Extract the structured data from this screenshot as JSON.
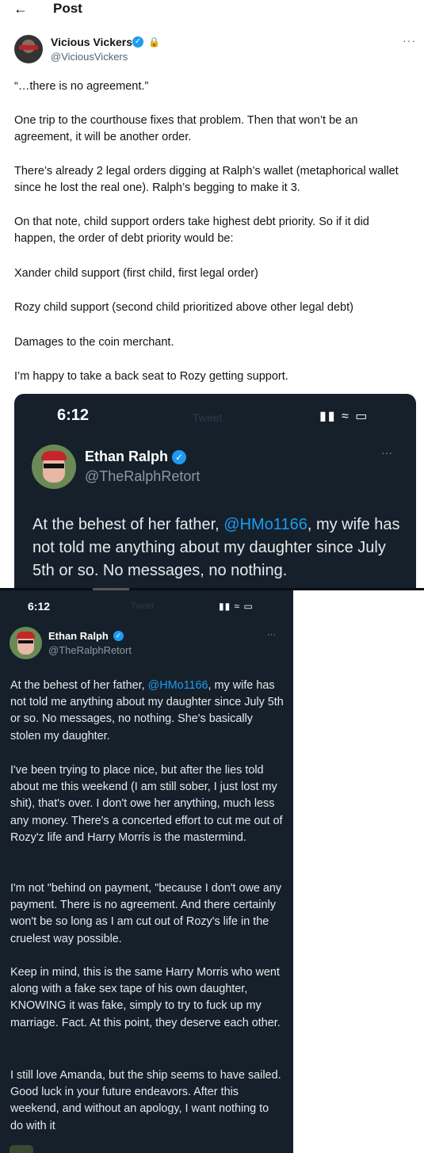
{
  "header": {
    "back_icon": "arrow-left-icon",
    "title": "Post"
  },
  "author": {
    "name": "Vicious Vickers",
    "handle": "@ViciousVickers",
    "verified": true,
    "protected": true
  },
  "tweet": {
    "paragraphs": [
      "“…there is no agreement.”",
      "One trip to the courthouse fixes that problem. Then that won’t be an agreement, it will be another order.",
      "There’s already 2 legal orders digging at Ralph’s wallet (metaphorical wallet since he lost the real one). Ralph’s begging to make it 3.",
      "On that note, child support orders take highest debt priority. So if it did happen, the order of debt priority would be:",
      "Xander child support (first child, first legal order)",
      "Rozy child support (second child prioritized above other legal debt)",
      "Damages to the coin merchant.",
      "I’m happy to take a back seat to Rozy getting support."
    ]
  },
  "screenshot1": {
    "time": "6:12",
    "ghost_title": "Tweet",
    "name": "Ethan Ralph",
    "handle": "@TheRalphRetort",
    "text_before_link": "At the behest of her father, ",
    "link": "@HMo1166",
    "text_after_link": ", my wife has not told me anything about my daughter since July 5th or so. No messages, no nothing."
  },
  "screenshot2": {
    "time": "6:12",
    "ghost_title": "Tweet",
    "name": "Ethan Ralph",
    "handle": "@TheRalphRetort",
    "p1_before_link": "At the behest of her father, ",
    "p1_link": "@HMo1166",
    "p1_after_link": ", my wife has not told me anything about my daughter since July 5th or so. No messages, no nothing. She's basically stolen my daughter.",
    "paragraphs": [
      "I've been trying to place nice, but after the lies told about me this weekend (I am still sober, I just lost my shit), that's over. I don't owe her anything, much less any money. There's a concerted effort to cut me out of Rozy'z life and Harry Morris is the mastermind.",
      "I'm not \"behind on payment, \"because I don't owe any payment. There is no agreement. And there certainly won't be so long as I am cut out of Rozy's life in the cruelest way possible.",
      "Keep in mind, this is the same Harry Morris who went along with a fake sex tape of his own daughter, KNOWING it was fake, simply to try to fuck up my marriage. Fact. At this point, they deserve each other.",
      "I still love Amanda, but the ship seems to have sailed. Good luck in your future endeavors. After this weekend, and without an apology, I want nothing to do with it"
    ]
  },
  "colors": {
    "accent": "#1d9bf0",
    "dark_bg": "#15202b"
  }
}
